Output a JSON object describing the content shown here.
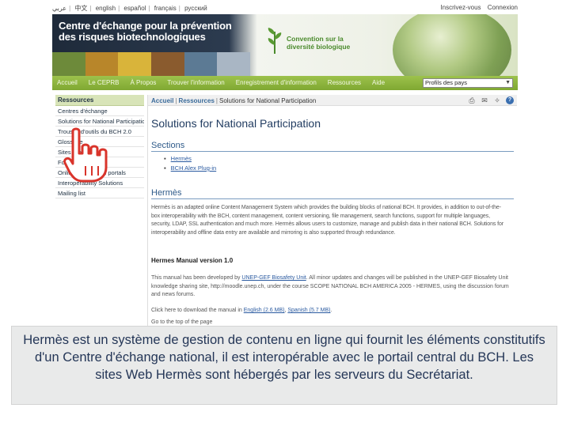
{
  "lang_bar": {
    "languages": [
      "عربي",
      "中文",
      "english",
      "español",
      "français",
      "русский"
    ],
    "auth": [
      "Inscrivez-vous",
      "Connexion"
    ]
  },
  "banner": {
    "title_line1": "Centre d'échange pour la prévention",
    "title_line2": "des risques biotechnologiques",
    "cbd_line1": "Convention sur la",
    "cbd_line2": "diversité biologique"
  },
  "nav": {
    "items": [
      "Accueil",
      "Le CEPRB",
      "À Propos",
      "Trouver l'information",
      "Enregistrement d'information",
      "Ressources",
      "Aide"
    ],
    "country_select": "Profils des pays"
  },
  "sidebar": {
    "header": "Ressources",
    "items": [
      "Centres d'échange",
      "Solutions for National Participation",
      "Trousse d'outils du BCH 2.0",
      "Glossaire",
      "Sites Web",
      "Formation",
      "Online forums and portals",
      "Interoperability Solutions",
      "Mailing list"
    ]
  },
  "main": {
    "breadcrumb": {
      "home": "Accueil",
      "section": "Ressources",
      "current": "Solutions for National Participation"
    },
    "title": "Solutions for National Participation",
    "sections_heading": "Sections",
    "sections": [
      "Hermès",
      "BCH Alex Plug-in"
    ],
    "hermes_heading": "Hermès",
    "hermes_text": "Hermès is an adapted online Content Management System which provides the building blocks of national BCH. It provides, in addition to out-of-the-box interoperability with the BCH, content management, content versioning, file management, search functions, support for multiple languages, security, LDAP, SSL authentication and much more. Hermès allows users to customize, manage and publish data in their national BCH. Solutions for interoperability and offline data entry are available and mirroring is also supported through redundance.",
    "manual_heading": "Hermes Manual version 1.0",
    "manual_text_pre": "This manual has been developed by ",
    "manual_link": "UNEP-GEF Biosafety Unit",
    "manual_text_post": ". All minor updates and changes will be published in the UNEP-GEF Biosafety Unit knowledge sharing site, http://moodle.unep.ch, under the course SCOPE NATIONAL BCH AMERICA 2005 - HERMES, using the discussion forum and news forums.",
    "download_pre": "Click here to download the manual in ",
    "download_en": "English (2.6 MB)",
    "download_mid": ", ",
    "download_es": "Spanish (5.7 MB)",
    "download_post": ".",
    "last_line": "Go to the top of the page"
  },
  "caption": {
    "text": "Hermès est un système de gestion de contenu en ligne qui fournit les éléments constitutifs d'un Centre d'échange national, il est interopérable avec le portail central du BCH. Les sites Web Hermès sont hébergés par les serveurs du Secrétariat."
  },
  "colors": {
    "nav_green": "#8db53e",
    "banner_dark": "#1e2a3a",
    "heading_blue": "#2f5b8a",
    "caption_text": "#243657",
    "cursor_red": "#d9342b"
  }
}
